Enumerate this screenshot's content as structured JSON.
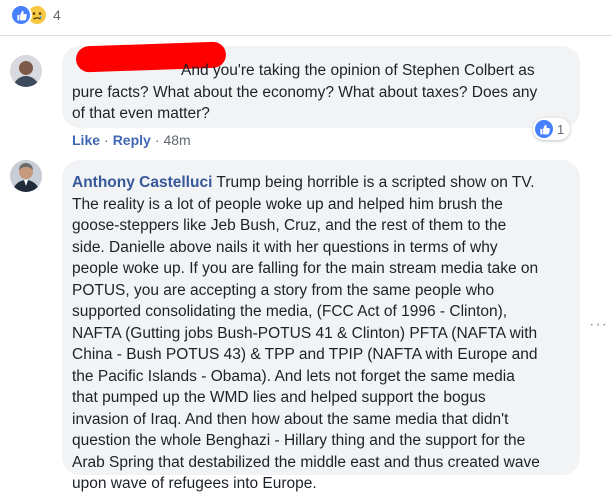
{
  "top_reactions": {
    "count": "4",
    "icons": [
      "like-icon",
      "sad-icon"
    ]
  },
  "comment1": {
    "author": "",
    "lines": [
      "And you're taking the opinion of Stephen Colbert as",
      "pure facts? What about the economy? What about taxes? Does any",
      "of that even matter?"
    ],
    "actions": {
      "like": "Like",
      "reply": "Reply",
      "time": "48m",
      "separator": "·"
    },
    "reaction_count": "1"
  },
  "comment2": {
    "author": "Anthony Castelluci",
    "first_line": "Trump being horrible is a scripted show on TV.",
    "lines": [
      "The reality is a lot of people woke up and helped him brush the",
      "goose-steppers like Jeb Bush, Cruz, and the rest of them to the",
      "side. Danielle above nails it with her questions in terms of why",
      "people woke up. If you are falling for the main stream media take on",
      "POTUS, you are accepting a story from the same people who",
      "supported consolidating the media, (FCC Act of 1996 - Clinton),",
      "NAFTA (Gutting jobs Bush-POTUS 41 & Clinton) PFTA (NAFTA with",
      "China - Bush POTUS 43) & TPP and TPIP (NAFTA with Europe and",
      "the Pacific Islands - Obama). And lets not forget the same media",
      "that pumped up the WMD lies and helped support the bogus",
      "invasion of Iraq. And then how about the same media that didn't",
      "question the whole Benghazi - Hillary thing and the support for the",
      "Arab Spring that destabilized the middle east and thus created wave",
      "upon wave of refugees into Europe."
    ]
  },
  "options_icon": "more-options-icon",
  "colors": {
    "link": "#365899",
    "action": "#4267b2",
    "bubble": "#f2f3f5",
    "like_blue": "#4680ff",
    "redaction": "#ff0000"
  }
}
